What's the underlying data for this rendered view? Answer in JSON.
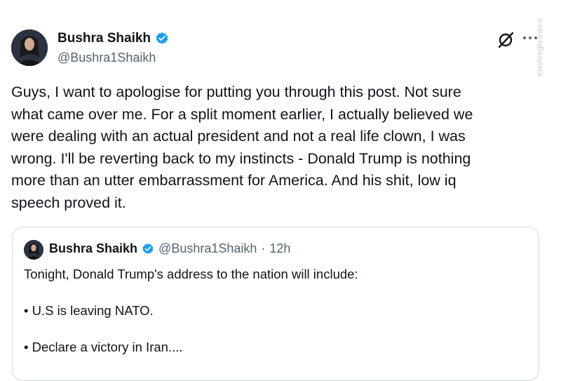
{
  "tweet": {
    "display_name": "Bushra Shaikh",
    "handle": "@Bushra1Shaikh",
    "text": "Guys, I want to apologise for putting you through this post. Not sure\nwhat came over me. For a split moment earlier, I actually believed we\nwere dealing with an actual president and not a real life clown, I was\nwrong. I'll be reverting back to my instincts - Donald Trump is nothing\nmore than an utter embarrassment for America. And his shit, low iq\nspeech proved it.",
    "verified_icon": "verified-badge-icon",
    "actions": {
      "grok_icon": "grok-icon",
      "more_icon": "more-icon"
    }
  },
  "quote": {
    "display_name": "Bushra Shaikh",
    "handle": "@Bushra1Shaikh",
    "separator": "·",
    "time": "12h",
    "line1": "Tonight, Donald Trump's address to the nation will include:",
    "bullet1": "• U.S is leaving NATO.",
    "bullet2": "• Declare a victory in Iran...."
  },
  "watermark": "mashreghnews.ir",
  "colors": {
    "text": "#0f1419",
    "secondary": "#536471",
    "verified": "#1d9bf0",
    "border": "#cfd9de"
  }
}
